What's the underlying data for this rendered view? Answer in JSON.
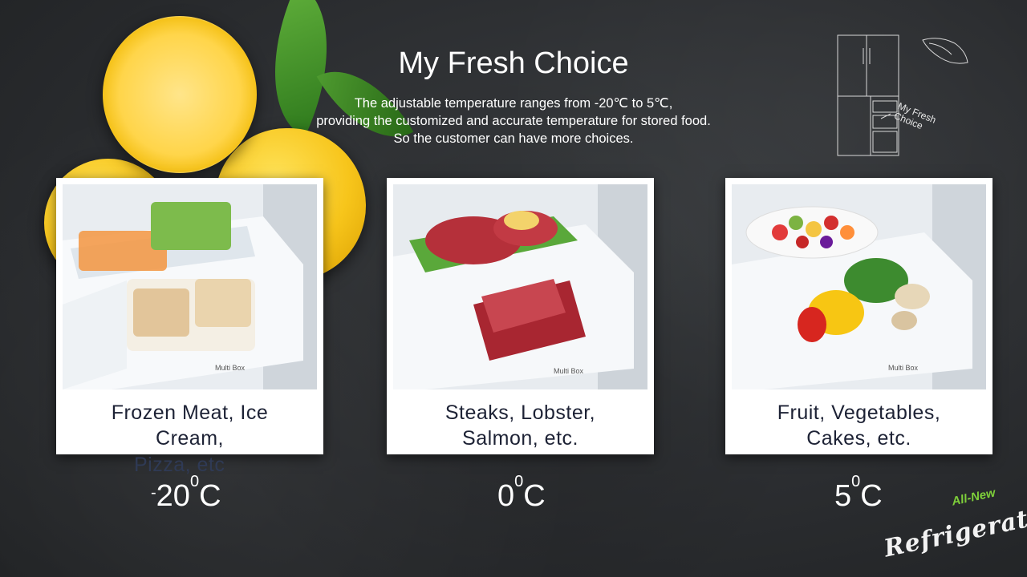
{
  "header": {
    "title": "My Fresh Choice",
    "subtitle_lines": [
      "The adjustable temperature ranges from -20℃ to 5℃,",
      "providing the customized and accurate temperature for stored food.",
      "So the customer can have more choices."
    ]
  },
  "sketch": {
    "label_line1": "My Fresh",
    "label_line2": "Choice"
  },
  "cards": [
    {
      "caption_line1": "Frozen Meat, Ice",
      "caption_line2": "Cream,",
      "overflow": "Pizza, etc",
      "box_label": "Multi Box"
    },
    {
      "caption_line1": "Steaks, Lobster,",
      "caption_line2": "Salmon, etc.",
      "box_label": "Multi Box"
    },
    {
      "caption_line1": "Fruit, Vegetables,",
      "caption_line2": "Cakes, etc.",
      "box_label": "Multi Box"
    }
  ],
  "temperatures": [
    {
      "sign": "-",
      "value": "20",
      "degree": "0",
      "unit": "C"
    },
    {
      "sign": "",
      "value": "0",
      "degree": "0",
      "unit": "C"
    },
    {
      "sign": "",
      "value": "5",
      "degree": "0",
      "unit": "C"
    }
  ],
  "brand": {
    "small": "All-New",
    "big": "Refrigerator"
  },
  "colors": {
    "accent_green": "#7ecf3a",
    "caption_text": "#1d2235"
  }
}
